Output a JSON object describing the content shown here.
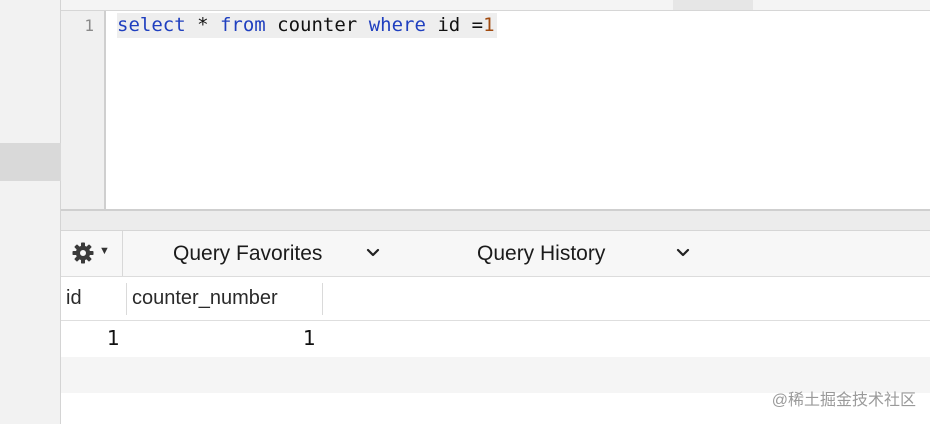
{
  "editor": {
    "line_number": "1",
    "code": {
      "t1": "select",
      "t2": " * ",
      "t3": "from",
      "t4": " counter ",
      "t5": "where",
      "t6": " id =",
      "t7": "1"
    }
  },
  "toolbar": {
    "favorites_label": "Query Favorites",
    "history_label": "Query History"
  },
  "results": {
    "columns": [
      "id",
      "counter_number"
    ],
    "rows": [
      [
        "1",
        "1"
      ]
    ]
  },
  "watermark": "@稀土掘金技术社区",
  "icons": {
    "settings": "gear-icon",
    "menu_caret": "caret-down-icon",
    "favorites_dropdown": "chevron-down-icon",
    "history_dropdown": "chevron-down-icon"
  }
}
